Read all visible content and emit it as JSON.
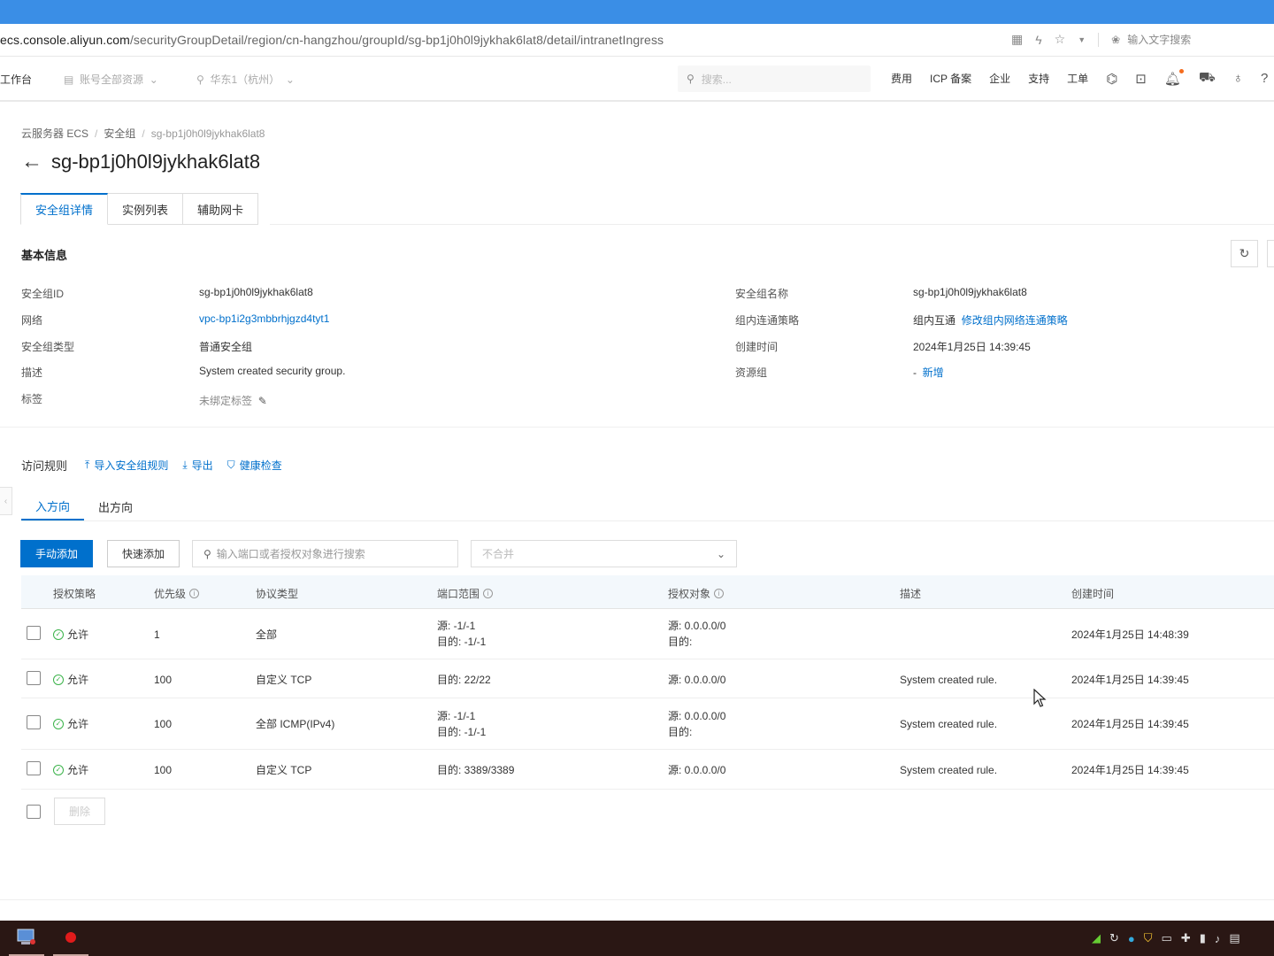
{
  "browser": {
    "url_host": "ecs.console.aliyun.com",
    "url_path": "/securityGroupDetail/region/cn-hangzhou/groupId/sg-bp1j0h0l9jykhak6lat8/detail/intranetIngress",
    "search_placeholder": "输入文字搜索"
  },
  "console_nav": {
    "workbench": "工作台",
    "account_resources": "账号全部资源",
    "region": "华东1（杭州）",
    "search_placeholder": "搜索...",
    "links": [
      "费用",
      "ICP 备案",
      "企业",
      "支持",
      "工单"
    ]
  },
  "breadcrumb": {
    "items": [
      "云服务器 ECS",
      "安全组",
      "sg-bp1j0h0l9jykhak6lat8"
    ],
    "separator": "/"
  },
  "page_title": "sg-bp1j0h0l9jykhak6lat8",
  "tabs": [
    "安全组详情",
    "实例列表",
    "辅助网卡"
  ],
  "basic_info": {
    "title": "基本信息",
    "left": [
      {
        "label": "安全组ID",
        "value": "sg-bp1j0h0l9jykhak6lat8"
      },
      {
        "label": "网络",
        "value": "vpc-bp1i2g3mbbrhjgzd4tyt1"
      },
      {
        "label": "安全组类型",
        "value": "普通安全组"
      },
      {
        "label": "描述",
        "value": "System created security group."
      },
      {
        "label": "标签",
        "value": "未绑定标签"
      }
    ],
    "right": [
      {
        "label": "安全组名称",
        "value": "sg-bp1j0h0l9jykhak6lat8"
      },
      {
        "label": "组内连通策略",
        "value": "组内互通",
        "link": "修改组内网络连通策略"
      },
      {
        "label": "创建时间",
        "value": "2024年1月25日 14:39:45"
      },
      {
        "label": "资源组",
        "value": "-",
        "link": "新增"
      }
    ]
  },
  "rules": {
    "title": "访问规则",
    "actions": [
      "导入安全组规则",
      "导出",
      "健康检查"
    ],
    "directions": [
      "入方向",
      "出方向"
    ],
    "add_manual": "手动添加",
    "add_quick": "快速添加",
    "search_placeholder": "输入端口或者授权对象进行搜索",
    "merge_select": "不合并",
    "columns": [
      "授权策略",
      "优先级",
      "协议类型",
      "端口范围",
      "授权对象",
      "描述",
      "创建时间"
    ],
    "rows": [
      {
        "policy": "允许",
        "priority": "1",
        "protocol": "全部",
        "port_src": "源: -1/-1",
        "port_dst": "目的: -1/-1",
        "obj_src": "源: 0.0.0.0/0",
        "obj_dst": "目的:",
        "desc": "",
        "created": "2024年1月25日 14:48:39"
      },
      {
        "policy": "允许",
        "priority": "100",
        "protocol": "自定义 TCP",
        "port_src": "",
        "port_dst": "目的: 22/22",
        "obj_src": "源: 0.0.0.0/0",
        "obj_dst": "",
        "desc": "System created rule.",
        "created": "2024年1月25日 14:39:45"
      },
      {
        "policy": "允许",
        "priority": "100",
        "protocol": "全部 ICMP(IPv4)",
        "port_src": "源: -1/-1",
        "port_dst": "目的: -1/-1",
        "obj_src": "源: 0.0.0.0/0",
        "obj_dst": "目的:",
        "desc": "System created rule.",
        "created": "2024年1月25日 14:39:45"
      },
      {
        "policy": "允许",
        "priority": "100",
        "protocol": "自定义 TCP",
        "port_src": "",
        "port_dst": "目的: 3389/3389",
        "obj_src": "源: 0.0.0.0/0",
        "obj_dst": "",
        "desc": "System created rule.",
        "created": "2024年1月25日 14:39:45"
      }
    ],
    "delete_label": "删除"
  },
  "colors": {
    "primary": "#0070cc",
    "top_strip": "#3a8ee6",
    "taskbar": "#2a1714",
    "allow_green": "#3bb34a"
  }
}
